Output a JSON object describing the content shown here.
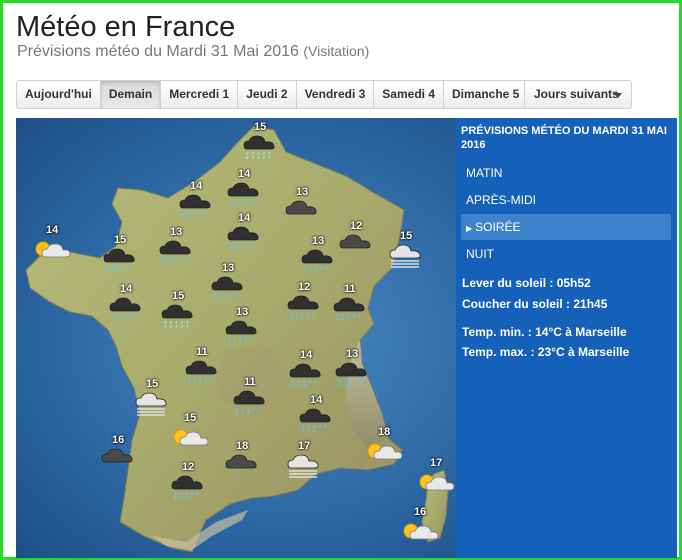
{
  "page": {
    "title": "Météo en France",
    "subtitle": "Prévisions météo du Mardi 31 Mai 2016",
    "subtitle_note": "(Visitation)"
  },
  "tabs": [
    {
      "label": "Aujourd'hui",
      "active": false
    },
    {
      "label": "Demain",
      "active": true
    },
    {
      "label": "Mercredi 1",
      "active": false
    },
    {
      "label": "Jeudi 2",
      "active": false
    },
    {
      "label": "Vendredi 3",
      "active": false
    },
    {
      "label": "Samedi 4",
      "active": false
    },
    {
      "label": "Dimanche 5",
      "active": false
    }
  ],
  "dropdown": {
    "label": "Jours suivants"
  },
  "panel": {
    "title": "PRÉVISIONS MÉTÉO DU MARDI 31 MAI 2016",
    "periods": [
      {
        "label": "MATIN",
        "active": false
      },
      {
        "label": "APRÈS-MIDI",
        "active": false
      },
      {
        "label": "SOIRÉE",
        "active": true
      },
      {
        "label": "NUIT",
        "active": false
      }
    ],
    "sunrise": "Lever du soleil : 05h52",
    "sunset": "Coucher du soleil : 21h45",
    "temp_min": "Temp. min. : 14°C à Marseille",
    "temp_max": "Temp. max. : 23°C à Marseille"
  },
  "icons": {
    "rain": "rain-cloud-icon",
    "cloud": "cloud-icon",
    "suncloud": "sun-cloud-icon",
    "fog": "fog-cloud-icon",
    "drizzle": "drizzle-cloud-icon"
  },
  "forecasts": [
    {
      "temp": "15",
      "icon": "drizzle"
    },
    {
      "temp": "14",
      "icon": "rain"
    },
    {
      "temp": "14",
      "icon": "rain"
    },
    {
      "temp": "13",
      "icon": "cloud"
    },
    {
      "temp": "14",
      "icon": "suncloud"
    },
    {
      "temp": "15",
      "icon": "rain"
    },
    {
      "temp": "13",
      "icon": "rain"
    },
    {
      "temp": "14",
      "icon": "rain"
    },
    {
      "temp": "12",
      "icon": "cloud"
    },
    {
      "temp": "15",
      "icon": "fog"
    },
    {
      "temp": "13",
      "icon": "rain"
    },
    {
      "temp": "14",
      "icon": "rain"
    },
    {
      "temp": "15",
      "icon": "drizzle"
    },
    {
      "temp": "13",
      "icon": "rain"
    },
    {
      "temp": "12",
      "icon": "rain"
    },
    {
      "temp": "11",
      "icon": "rain"
    },
    {
      "temp": "13",
      "icon": "rain"
    },
    {
      "temp": "11",
      "icon": "rain"
    },
    {
      "temp": "14",
      "icon": "rain"
    },
    {
      "temp": "13",
      "icon": "rain"
    },
    {
      "temp": "15",
      "icon": "fog"
    },
    {
      "temp": "11",
      "icon": "rain"
    },
    {
      "temp": "14",
      "icon": "rain"
    },
    {
      "temp": "15",
      "icon": "suncloud"
    },
    {
      "temp": "16",
      "icon": "cloud"
    },
    {
      "temp": "18",
      "icon": "cloud"
    },
    {
      "temp": "17",
      "icon": "fog"
    },
    {
      "temp": "18",
      "icon": "suncloud"
    },
    {
      "temp": "12",
      "icon": "rain"
    },
    {
      "temp": "17",
      "icon": "suncloud"
    },
    {
      "temp": "16",
      "icon": "suncloud"
    }
  ]
}
